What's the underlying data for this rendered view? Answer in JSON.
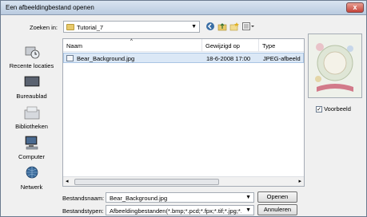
{
  "window": {
    "title": "Een afbeeldingbestand openen",
    "close_label": "x"
  },
  "lookin": {
    "label": "Zoeken in:",
    "value": "Tutorial_7"
  },
  "places": [
    {
      "id": "recent",
      "label": "Recente locaties"
    },
    {
      "id": "desktop",
      "label": "Bureaublad"
    },
    {
      "id": "libraries",
      "label": "Bibliotheken"
    },
    {
      "id": "computer",
      "label": "Computer"
    },
    {
      "id": "network",
      "label": "Netwerk"
    }
  ],
  "columns": {
    "name": "Naam",
    "modified": "Gewijzigd op",
    "type": "Type"
  },
  "files": [
    {
      "name": "Bear_Background.jpg",
      "modified": "18-6-2008 17:00",
      "type": "JPEG-afbeeld"
    }
  ],
  "preview": {
    "label": "Voorbeeld",
    "checked": true
  },
  "filename": {
    "label": "Bestandsnaam:",
    "value": "Bear_Background.jpg"
  },
  "filetype": {
    "label": "Bestandstypen:",
    "value": "Afbeeldingbestanden(*.bmp;*.pcd;*.fpx;*.tif;*.jpg;*.pcx"
  },
  "buttons": {
    "open": "Openen",
    "cancel": "Annuleren"
  },
  "colors": {
    "selection_bg": "#dbe8f6",
    "selection_border": "#a9c4e4",
    "titlebar": "#c9d7e8"
  }
}
